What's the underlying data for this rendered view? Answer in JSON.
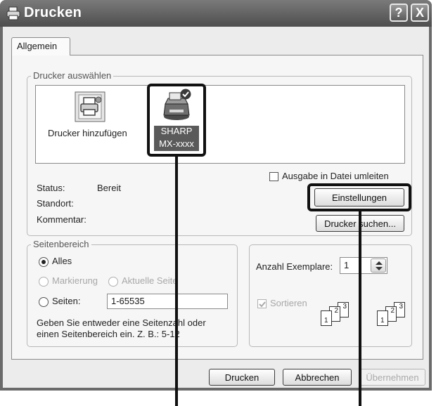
{
  "window": {
    "title": "Drucken",
    "help_button": "?",
    "close_button": "X"
  },
  "tabs": [
    {
      "label": "Allgemein",
      "selected": true
    }
  ],
  "printer_group": {
    "legend": "Drucker auswählen",
    "items": [
      {
        "label": "Drucker hinzufügen",
        "icon": "add-printer-icon",
        "selected": false
      },
      {
        "label_line1": "SHARP",
        "label_line2": "MX-xxxx",
        "icon": "printer-icon",
        "selected": true,
        "default": true
      }
    ]
  },
  "status": {
    "status_label": "Status:",
    "status_value": "Bereit",
    "location_label": "Standort:",
    "comment_label": "Kommentar:"
  },
  "print_to_file": {
    "label": "Ausgabe in Datei umleiten",
    "checked": false
  },
  "buttons": {
    "settings": "Einstellungen",
    "find_printer": "Drucker suchen...",
    "print": "Drucken",
    "cancel": "Abbrechen",
    "apply": "Übernehmen"
  },
  "page_range": {
    "legend": "Seitenbereich",
    "all": "Alles",
    "selection": "Markierung",
    "current_page": "Aktuelle Seite",
    "pages": "Seiten:",
    "pages_value": "1-65535",
    "hint": "Geben Sie entweder eine Seitenzahl oder einen Seitenbereich ein. Z. B.: 5-12",
    "hint_line1": "Geben Sie entweder eine Seitenzahl oder",
    "hint_line2": "einen Seitenbereich ein. Z. B.: 5-12",
    "selected": "all"
  },
  "copies": {
    "label": "Anzahl Exemplare:",
    "value": "1",
    "collate_label": "Sortieren",
    "collate_checked": true,
    "collate_pages": [
      "1",
      "2",
      "3"
    ]
  },
  "colors": {
    "titlebar": "#5c5c5c",
    "callout": "#111111"
  }
}
